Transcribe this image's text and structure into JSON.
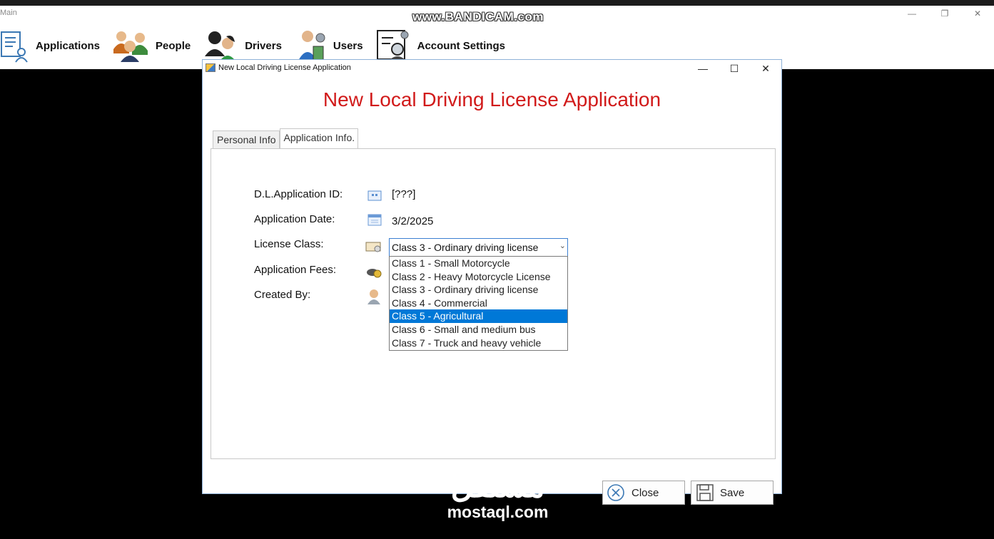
{
  "main_window": {
    "title": "Main",
    "watermark": "www.BANDICAM.com",
    "menu": [
      {
        "label": "Applications",
        "icon": "document-user-icon"
      },
      {
        "label": "People",
        "icon": "people-group-icon"
      },
      {
        "label": "Drivers",
        "icon": "drivers-icon"
      },
      {
        "label": "Users",
        "icon": "users-gear-icon"
      },
      {
        "label": "Account Settings",
        "icon": "account-settings-icon"
      }
    ]
  },
  "dialog": {
    "title": "New Local Driving License Application",
    "header": "New Local Driving License Application",
    "tabs": [
      {
        "label": "Personal Info",
        "active": false
      },
      {
        "label": "Application Info.",
        "active": true
      }
    ],
    "fields": {
      "app_id_label": "D.L.Application ID:",
      "app_id_value": "[???]",
      "app_date_label": "Application Date:",
      "app_date_value": "3/2/2025",
      "license_class_label": "License Class:",
      "fees_label": "Application Fees:",
      "created_by_label": "Created By:"
    },
    "license_class": {
      "selected": "Class 3 - Ordinary driving license",
      "highlighted": "Class 5 - Agricultural",
      "options": [
        "Class 1 - Small Motorcycle",
        "Class 2 - Heavy Motorcycle License",
        "Class 3 - Ordinary driving license",
        "Class 4 - Commercial",
        "Class 5 - Agricultural",
        "Class 6 - Small and medium bus",
        "Class 7 - Truck and heavy vehicle"
      ]
    },
    "buttons": {
      "close": "Close",
      "save": "Save"
    }
  },
  "overlay_logo": {
    "arabic": "مستقل",
    "latin": "mostaql.com"
  },
  "colors": {
    "header": "#d11a1a",
    "selection": "#0078d7",
    "accent_border": "#3c7fd1"
  }
}
